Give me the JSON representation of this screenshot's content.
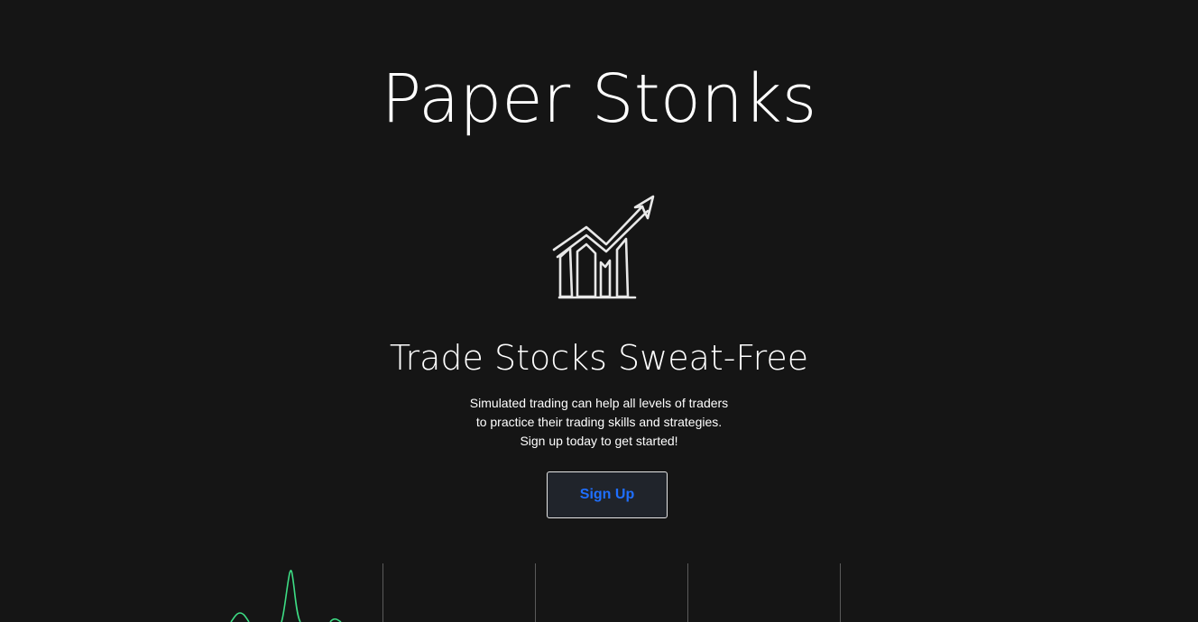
{
  "hero": {
    "title": "Paper Stonks",
    "icon": "growth-chart-icon",
    "tagline": "Trade Stocks Sweat-Free",
    "description_lines": [
      "Simulated trading can help all levels of traders",
      "to practice their trading skills and strategies.",
      "Sign up today to get started!"
    ],
    "signup_label": "Sign Up"
  },
  "colors": {
    "background": "#151515",
    "text": "#ffffff",
    "button_bg": "#20242b",
    "button_text": "#1f6fff",
    "chart_line": "#3ddc84",
    "divider": "#5a5a5a"
  }
}
